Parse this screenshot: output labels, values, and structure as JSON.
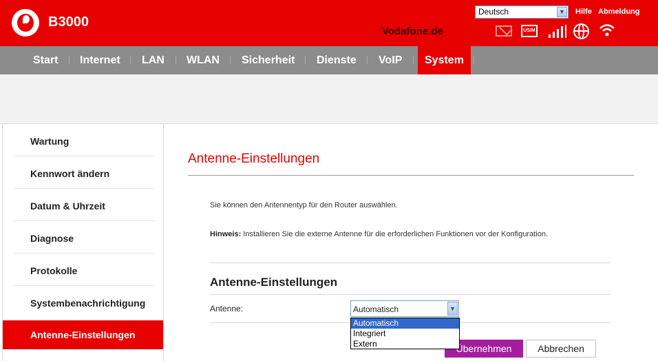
{
  "header": {
    "model": "B3000",
    "site": "Vodafone.de",
    "language": "Deutsch",
    "help": "Hilfe",
    "logout": "Abmeldung",
    "usim": "USIM"
  },
  "nav": {
    "items": [
      "Start",
      "Internet",
      "LAN",
      "WLAN",
      "Sicherheit",
      "Dienste",
      "VoIP",
      "System"
    ],
    "active": "System"
  },
  "sidebar": {
    "items": [
      "Wartung",
      "Kennwort ändern",
      "Datum & Uhrzeit",
      "Diagnose",
      "Protokolle",
      "Systembenachrichtigung",
      "Antenne-Einstellungen"
    ],
    "active": "Antenne-Einstellungen"
  },
  "main": {
    "page_title": "Antenne-Einstellungen",
    "description": "Sie können den Antennentyp für den Router auswählen.",
    "hint_label": "Hinweis:",
    "hint_text": " Installieren Sie die externe Antenne für die erforderlichen Funktionen vor der Konfiguration.",
    "section_title": "Antenne-Einstellungen",
    "antenna_label": "Antenne:",
    "antenna_value": "Automatisch",
    "antenna_options": [
      "Automatisch",
      "Integriert",
      "Extern"
    ],
    "apply_label": "Übernehmen",
    "cancel_label": "Abbrechen"
  },
  "colors": {
    "brand_red": "#e60000",
    "nav_gray": "#8c8c8c",
    "apply_purple": "#a51d9e"
  }
}
